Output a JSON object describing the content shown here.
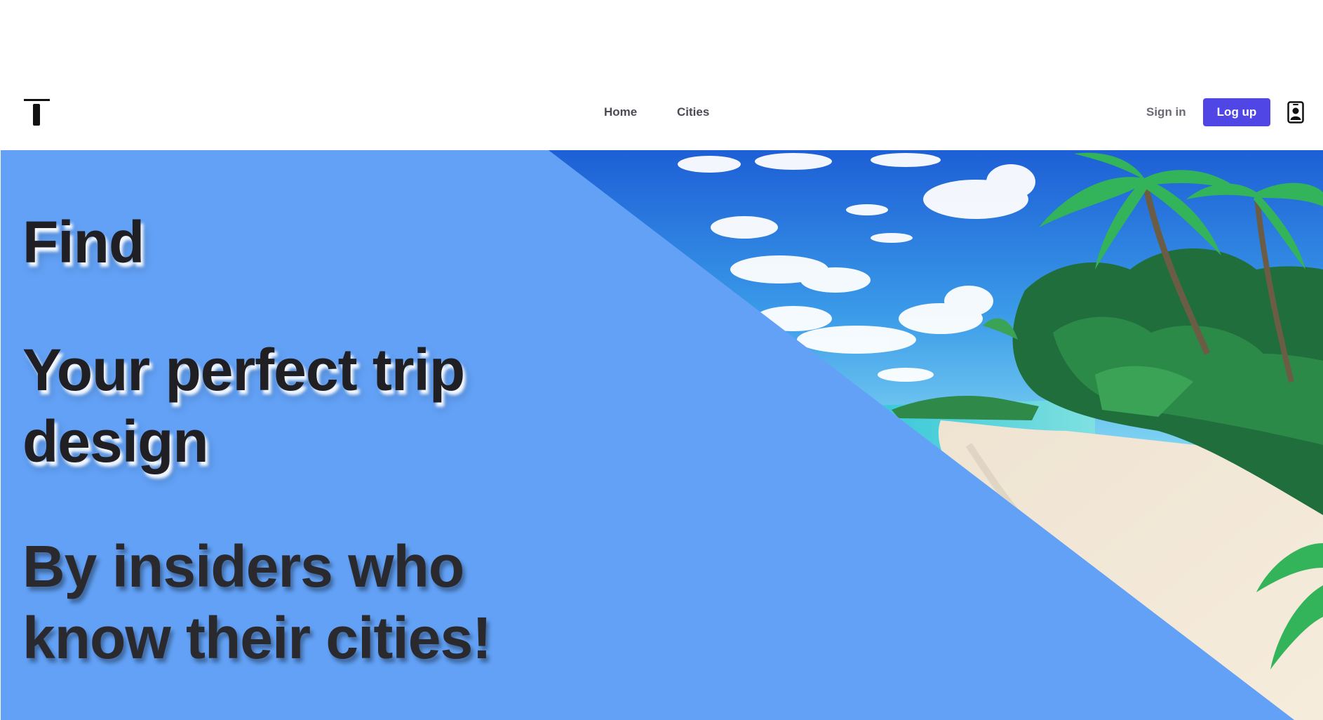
{
  "header": {
    "logo_icon": "t-logo-icon",
    "nav": {
      "home_label": "Home",
      "cities_label": "Cities"
    },
    "sign_in_label": "Sign in",
    "log_up_label": "Log up",
    "profile_icon": "user-badge-icon"
  },
  "hero": {
    "line1": "Find",
    "line2_a": "Your perfect trip",
    "line2_b": "design",
    "line3_a": "By insiders who",
    "line3_b": "know their cities!",
    "background_color": "#62a1f6",
    "image": "tropical-beach-illustration"
  },
  "colors": {
    "accent": "#4f46e5",
    "hero_blue": "#62a1f6",
    "text_dark": "#1f1f24"
  }
}
